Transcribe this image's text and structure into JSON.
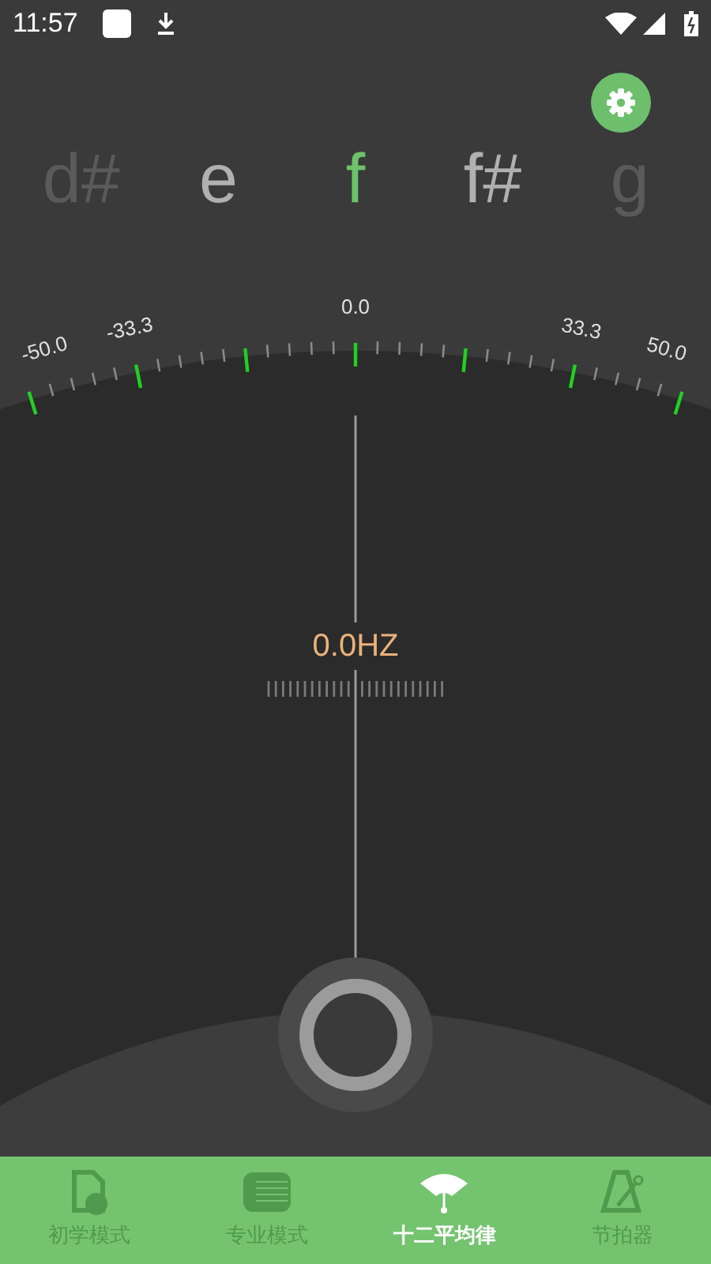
{
  "status_bar": {
    "time": "11:57"
  },
  "notes": [
    {
      "label": "d#",
      "selected": false
    },
    {
      "label": "e",
      "selected": false
    },
    {
      "label": "f",
      "selected": true
    },
    {
      "label": "f#",
      "selected": false
    },
    {
      "label": "g",
      "selected": false
    }
  ],
  "scale_labels": [
    "-50.0",
    "-33.3",
    "0.0",
    "33.3",
    "50.0"
  ],
  "frequency": "0.0HZ",
  "nav": [
    {
      "label": "初学模式",
      "selected": false
    },
    {
      "label": "专业模式",
      "selected": false
    },
    {
      "label": "十二平均律",
      "selected": true
    },
    {
      "label": "节拍器",
      "selected": false
    }
  ]
}
